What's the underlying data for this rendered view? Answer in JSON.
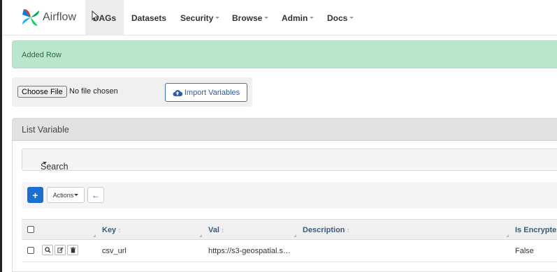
{
  "navbar": {
    "brand": "Airflow",
    "items": [
      {
        "label": "DAGs",
        "active": true,
        "dropdown": false
      },
      {
        "label": "Datasets",
        "active": false,
        "dropdown": false
      },
      {
        "label": "Security",
        "active": false,
        "dropdown": true
      },
      {
        "label": "Browse",
        "active": false,
        "dropdown": true
      },
      {
        "label": "Admin",
        "active": false,
        "dropdown": true
      },
      {
        "label": "Docs",
        "active": false,
        "dropdown": true
      }
    ]
  },
  "alert": {
    "message": "Added Row",
    "color": "#b9e6cc"
  },
  "import": {
    "choose_file_label": "Choose File",
    "no_file_label": "No file chosen",
    "import_button_label": "Import Variables",
    "import_icon": "cloud-upload-icon"
  },
  "panel": {
    "title": "List Variable",
    "search_label": "Search",
    "toolbar": {
      "add_label": "+",
      "actions_label": "Actions",
      "back_icon": "arrow-left-icon"
    },
    "table": {
      "columns": [
        "Key",
        "Val",
        "Description",
        "Is Encrypte"
      ],
      "rows": [
        {
          "key": "csv_url",
          "val": "https://s3-geospatial.s…",
          "description": "",
          "is_encrypted": "False"
        }
      ],
      "row_action_icons": [
        "search-icon",
        "edit-icon",
        "trash-icon"
      ]
    }
  },
  "colors": {
    "primary": "#1a6fd1",
    "alert_bg": "#b9e6cc",
    "header_text": "#3b5a7a"
  }
}
